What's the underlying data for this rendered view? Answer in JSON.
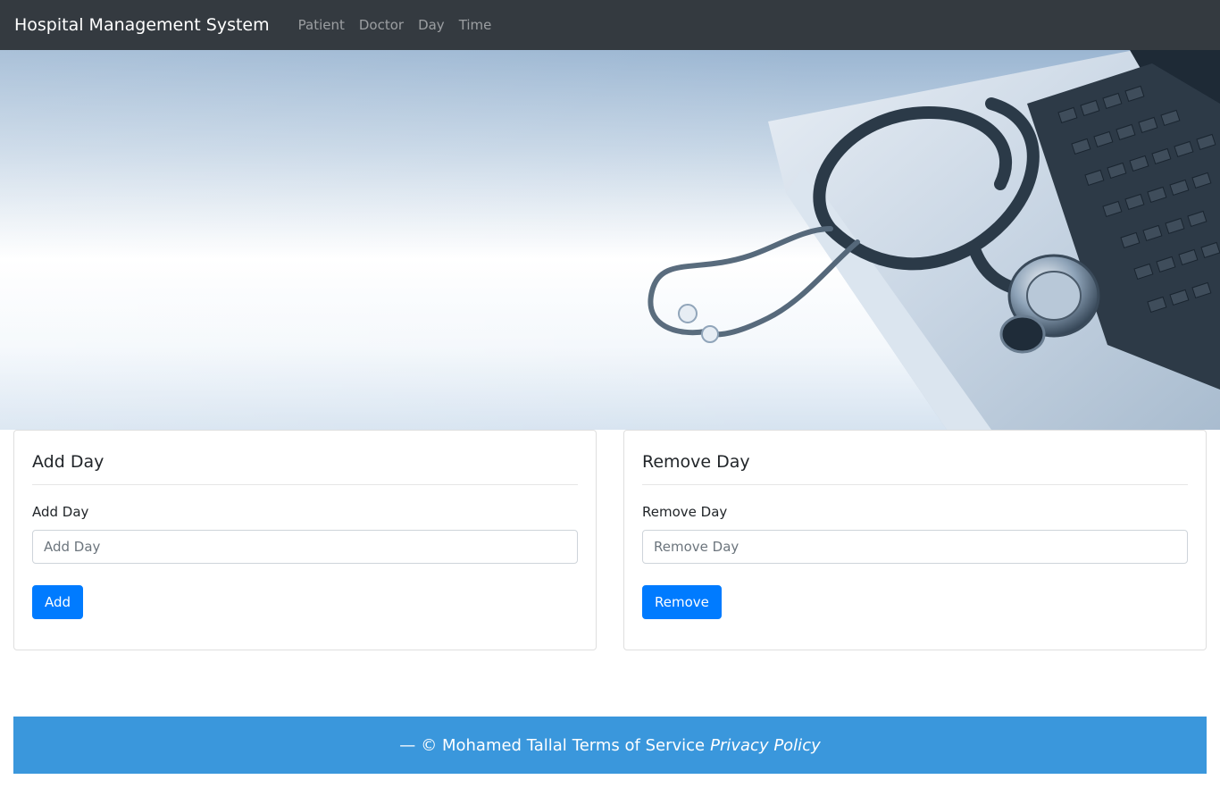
{
  "navbar": {
    "brand": "Hospital Management System",
    "links": [
      "Patient",
      "Doctor",
      "Day",
      "Time"
    ]
  },
  "hero": {
    "image": "stethoscope-on-laptop-image"
  },
  "add_card": {
    "title": "Add Day",
    "label": "Add Day",
    "placeholder": "Add Day",
    "value": "",
    "button": "Add"
  },
  "remove_card": {
    "title": "Remove Day",
    "label": "Remove Day",
    "placeholder": "Remove Day",
    "value": "",
    "button": "Remove"
  },
  "footer": {
    "dash": "—",
    "copyright": "© Mohamed Tallal",
    "terms": "Terms of Service",
    "privacy": "Privacy Policy"
  },
  "colors": {
    "navbar": "#343a40",
    "primary": "#007bff",
    "footer": "#3a97dc"
  }
}
